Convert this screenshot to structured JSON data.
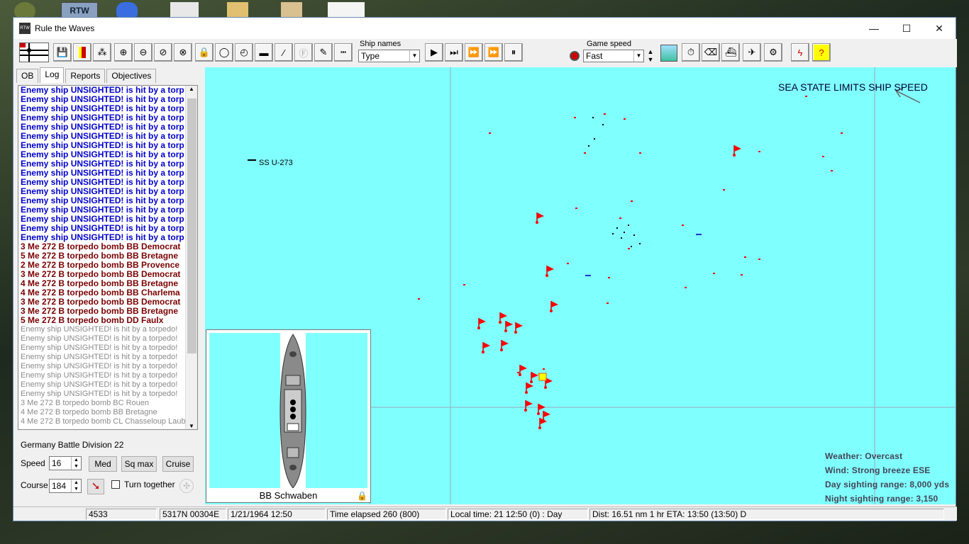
{
  "window": {
    "title": "Rule the Waves",
    "minimize": "—",
    "maximize": "☐",
    "close": "✕"
  },
  "desktop": {
    "icon_label": "RTW"
  },
  "toolbar": {
    "ship_names_label": "Ship names",
    "ship_names_value": "Type",
    "game_speed_label": "Game speed",
    "game_speed_value": "Fast"
  },
  "tabs": [
    "OB",
    "Log",
    "Reports",
    "Objectives"
  ],
  "log": {
    "blue_line": "Enemy ship UNSIGHTED! is hit by a torp",
    "blue_count": 17,
    "red_lines": [
      "3 Me 272 B  torpedo bomb  BB Democrat",
      "5 Me 272 B  torpedo bomb  BB Bretagne",
      "2 Me 272 B  torpedo bomb  BB Provence",
      "3 Me 272 B  torpedo bomb  BB Democrat",
      "4 Me 272 B  torpedo bomb  BB Bretagne",
      "4 Me 272 B  torpedo bomb  BB Charlema",
      "3 Me 272 B  torpedo bomb  BB Democrat",
      "3 Me 272 B  torpedo bomb  BB Bretagne",
      "5 Me 272 B  torpedo bomb  DD Faulx"
    ],
    "gray_line": "Enemy ship UNSIGHTED! is hit by a torpedo!",
    "gray_count": 8,
    "gray_tail": [
      "3 Me 272 B  torpedo bomb  BC Rouen",
      "4 Me 272 B  torpedo bomb  BB Bretagne",
      "4 Me 272 B  torpedo bomb  CL Chasseloup Laub"
    ]
  },
  "division": {
    "name": "Germany Battle Division 22",
    "speed_label": "Speed",
    "speed_value": "16",
    "course_label": "Course",
    "course_value": "184",
    "btn_med": "Med",
    "btn_sqmax": "Sq max",
    "btn_cruise": "Cruise",
    "turn_together_label": "Turn together"
  },
  "inset": {
    "ship_caption": "BB Schwaben"
  },
  "map": {
    "sea_state": "SEA STATE LIMITS SHIP SPEED",
    "contact_label": "SS U-273",
    "weather": "Weather: Overcast",
    "wind": "Wind: Strong breeze  ESE",
    "day_sighting": "Day sighting range: 8,000 yds",
    "night_sighting": "Night sighting range: 3,150 yds"
  },
  "status": {
    "f1": "4533",
    "f2": "5317N 00304E",
    "f3": "1/21/1964 12:50",
    "f4": "Time elapsed 260 (800)",
    "f5": "Local time: 21 12:50 (0) : Day",
    "f6": "Dist: 16.51 nm 1 hr ETA: 13:50 (13:50) D"
  },
  "colors": {
    "sea": "#80ffff",
    "enemy": "#ff0000",
    "log_blue": "#0000cc",
    "log_red": "#7a0000"
  }
}
